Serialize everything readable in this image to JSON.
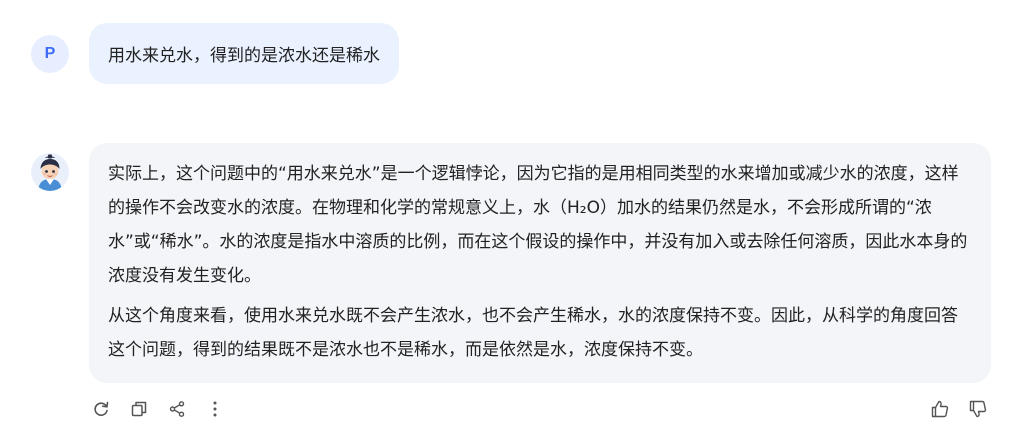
{
  "conversation": {
    "user": {
      "avatar_letter": "P",
      "message": "用水来兑水，得到的是浓水还是稀水"
    },
    "assistant": {
      "paragraphs": [
        "实际上，这个问题中的“用水来兑水”是一个逻辑悖论，因为它指的是用相同类型的水来增加或减少水的浓度，这样的操作不会改变水的浓度。在物理和化学的常规意义上，水（H₂O）加水的结果仍然是水，不会形成所谓的“浓水”或“稀水”。水的浓度是指水中溶质的比例，而在这个假设的操作中，并没有加入或去除任何溶质，因此水本身的浓度没有发生变化。",
        "从这个角度来看，使用水来兑水既不会产生浓水，也不会产生稀水，水的浓度保持不变。因此，从科学的角度回答这个问题，得到的结果既不是浓水也不是稀水，而是依然是水，浓度保持不变。"
      ]
    }
  },
  "actions": {
    "left": [
      "refresh-icon",
      "copy-icon",
      "share-icon",
      "more-icon"
    ],
    "right": [
      "thumbs-up-icon",
      "thumbs-down-icon"
    ]
  },
  "colors": {
    "user_bubble": "#eaf2ff",
    "bot_bubble": "#f4f5f9",
    "accent": "#3d6ef5",
    "icon": "#555555"
  }
}
